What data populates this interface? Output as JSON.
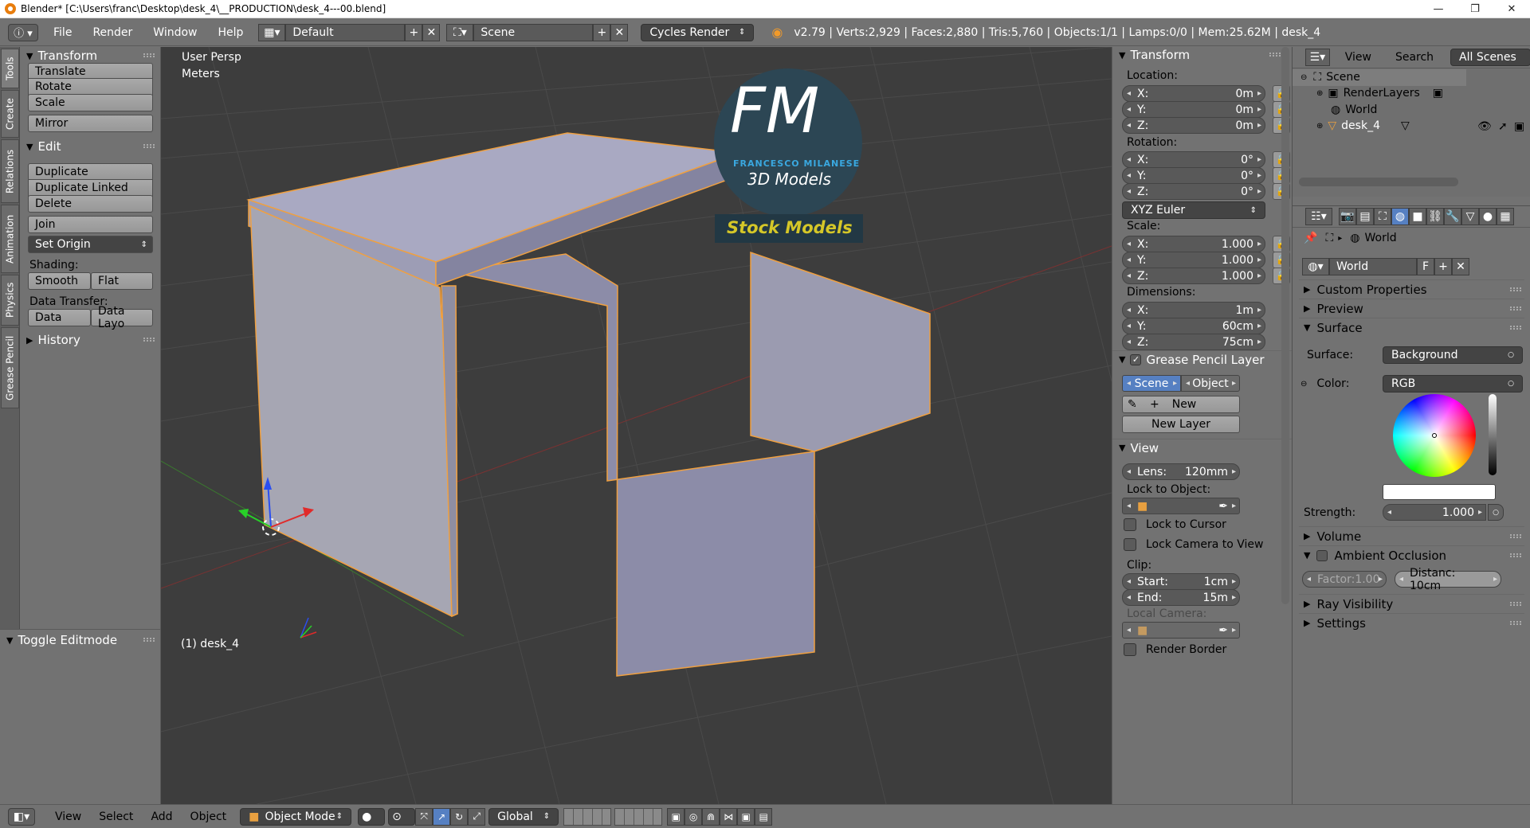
{
  "titlebar": {
    "title": "Blender* [C:\\Users\\franc\\Desktop\\desk_4\\__PRODUCTION\\desk_4---00.blend]",
    "minimize": "—",
    "maximize": "❐",
    "close": "✕"
  },
  "infobar": {
    "menus": [
      "File",
      "Render",
      "Window",
      "Help"
    ],
    "screen_layout": "Default",
    "scene": "Scene",
    "render_engine": "Cycles Render",
    "stats": "v2.79 | Verts:2,929 | Faces:2,880 | Tris:5,760 | Objects:1/1 | Lamps:0/0 | Mem:25.62M | desk_4"
  },
  "left_tabs": [
    "Tools",
    "Create",
    "Relations",
    "Animation",
    "Physics",
    "Grease Pencil"
  ],
  "toolshelf": {
    "transform_title": "Transform",
    "translate": "Translate",
    "rotate": "Rotate",
    "scale": "Scale",
    "mirror": "Mirror",
    "edit_title": "Edit",
    "duplicate": "Duplicate",
    "duplicate_linked": "Duplicate Linked",
    "delete": "Delete",
    "join": "Join",
    "set_origin": "Set Origin",
    "shading_label": "Shading:",
    "smooth": "Smooth",
    "flat": "Flat",
    "data_transfer_label": "Data Transfer:",
    "data": "Data",
    "data_layo": "Data Layo",
    "history_title": "History",
    "toggle_editmode": "Toggle Editmode"
  },
  "viewport": {
    "view_name": "User Persp",
    "units": "Meters",
    "object_label": "(1) desk_4",
    "logo_letters": "FM",
    "logo_name": "FRANCESCO MILANESE",
    "logo_sub": "3D Models",
    "logo_banner": "Stock Models"
  },
  "npanel": {
    "transform_title": "Transform",
    "location_label": "Location:",
    "location": [
      {
        "axis": "X:",
        "value": "0m"
      },
      {
        "axis": "Y:",
        "value": "0m"
      },
      {
        "axis": "Z:",
        "value": "0m"
      }
    ],
    "rotation_label": "Rotation:",
    "rotation": [
      {
        "axis": "X:",
        "value": "0°"
      },
      {
        "axis": "Y:",
        "value": "0°"
      },
      {
        "axis": "Z:",
        "value": "0°"
      }
    ],
    "rotation_mode": "XYZ Euler",
    "scale_label": "Scale:",
    "scale": [
      {
        "axis": "X:",
        "value": "1.000"
      },
      {
        "axis": "Y:",
        "value": "1.000"
      },
      {
        "axis": "Z:",
        "value": "1.000"
      }
    ],
    "dimensions_label": "Dimensions:",
    "dimensions": [
      {
        "axis": "X:",
        "value": "1m"
      },
      {
        "axis": "Y:",
        "value": "60cm"
      },
      {
        "axis": "Z:",
        "value": "75cm"
      }
    ],
    "gp_title": "Grease Pencil Layer",
    "gp_scene": "Scene",
    "gp_object": "Object",
    "gp_new": "New",
    "gp_new_layer": "New Layer",
    "view_title": "View",
    "lens_label": "Lens:",
    "lens_value": "120mm",
    "lock_to_object": "Lock to Object:",
    "lock_to_cursor": "Lock to Cursor",
    "lock_camera": "Lock Camera to View",
    "clip_label": "Clip:",
    "clip_start_label": "Start:",
    "clip_start": "1cm",
    "clip_end_label": "End:",
    "clip_end": "15m",
    "local_camera": "Local Camera:",
    "render_border": "Render Border"
  },
  "outliner": {
    "menus": [
      "View",
      "Search"
    ],
    "filter": "All Scenes",
    "items": [
      "Scene",
      "RenderLayers",
      "World",
      "desk_4"
    ]
  },
  "properties": {
    "context_world": "World",
    "world_field": "World",
    "world_f": "F",
    "custom_properties": "Custom Properties",
    "preview": "Preview",
    "surface_title": "Surface",
    "surface_label": "Surface:",
    "surface_value": "Background",
    "color_label": "Color:",
    "color_value": "RGB",
    "strength_label": "Strength:",
    "strength_value": "1.000",
    "volume": "Volume",
    "ambient_occlusion": "Ambient Occlusion",
    "factor_label": "Factor:",
    "factor_value": "1.00",
    "distance": "Distanc: 10cm",
    "ray_visibility": "Ray Visibility",
    "settings": "Settings"
  },
  "bottombar": {
    "menus": [
      "View",
      "Select",
      "Add",
      "Object"
    ],
    "mode": "Object Mode",
    "orientation": "Global"
  }
}
